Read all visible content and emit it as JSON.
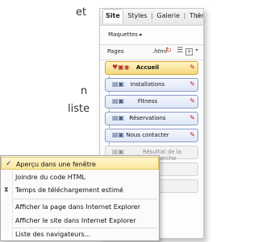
{
  "background": {
    "lines": [
      "et",
      "n",
      "liste"
    ]
  },
  "panel": {
    "tabs": [
      "Site",
      "Styles",
      "Galerie",
      "Thèmes Graphiques"
    ],
    "scroll_right_icon": "chevron-right-icon",
    "maquettes_label": "Maquettes ▸",
    "pages_label": "Pages",
    "ext_label": ".html",
    "pages": [
      {
        "name": "Accueil",
        "style": "highlighted"
      },
      {
        "name": "Installations",
        "style": "normal"
      },
      {
        "name": "Fitness",
        "style": "normal"
      },
      {
        "name": "Réservations",
        "style": "normal"
      },
      {
        "name": "Nous contacter",
        "style": "normal"
      },
      {
        "name": "Résultat de la recherche",
        "style": "dim"
      }
    ]
  },
  "menu": {
    "items": [
      {
        "label": "Aperçu dans une fenêtre",
        "checked": true
      },
      {
        "label": "Joindre du code HTML"
      },
      {
        "label": "Temps de téléchargement estimé"
      },
      {
        "label": "Afficher la page dans Internet Explorer"
      },
      {
        "label": "Afficher le site dans Internet Explorer"
      },
      {
        "label": "Liste des navigateurs..."
      }
    ]
  }
}
